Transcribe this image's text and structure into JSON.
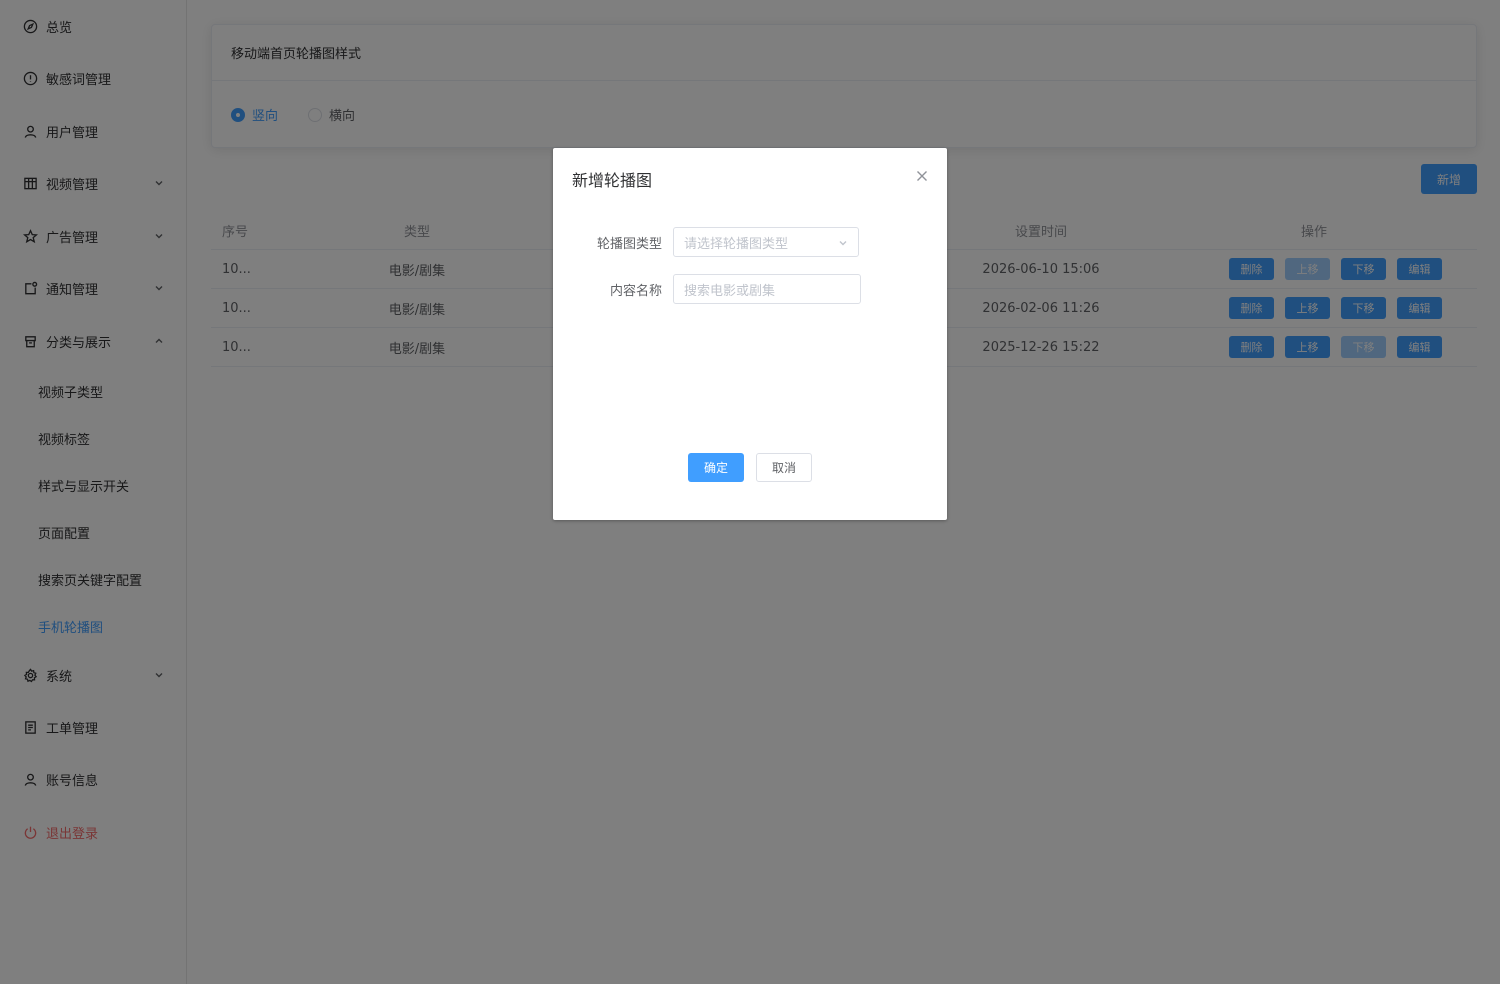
{
  "sidebar": {
    "items": [
      {
        "label": "总览",
        "icon": "compass-icon"
      },
      {
        "label": "敏感词管理",
        "icon": "warning-circle-icon"
      },
      {
        "label": "用户管理",
        "icon": "user-icon"
      },
      {
        "label": "视频管理",
        "icon": "grid-icon",
        "expandable": true
      },
      {
        "label": "广告管理",
        "icon": "star-icon",
        "expandable": true
      },
      {
        "label": "通知管理",
        "icon": "notification-icon",
        "expandable": true
      },
      {
        "label": "分类与展示",
        "icon": "box-icon",
        "expandable": true,
        "expanded": true
      },
      {
        "label": "系统",
        "icon": "gear-icon",
        "expandable": true
      },
      {
        "label": "工单管理",
        "icon": "document-icon"
      },
      {
        "label": "账号信息",
        "icon": "user-icon"
      },
      {
        "label": "退出登录",
        "icon": "power-icon",
        "color": "#f56c6c"
      }
    ],
    "subitems": [
      {
        "label": "视频子类型"
      },
      {
        "label": "视频标签"
      },
      {
        "label": "样式与显示开关"
      },
      {
        "label": "页面配置"
      },
      {
        "label": "搜索页关键字配置"
      },
      {
        "label": "手机轮播图",
        "active": true
      }
    ]
  },
  "card": {
    "title": "移动端首页轮播图样式",
    "options": [
      {
        "label": "竖向",
        "checked": true
      },
      {
        "label": "横向",
        "checked": false
      }
    ]
  },
  "add_button": "新增",
  "table": {
    "headers": {
      "seq": "序号",
      "type": "类型",
      "time": "设置时间",
      "ops": "操作"
    },
    "rows": [
      {
        "seq": "10...",
        "type": "电影/剧集",
        "time": "2026-06-10 15:06",
        "up_disabled": true,
        "down_disabled": false
      },
      {
        "seq": "10...",
        "type": "电影/剧集",
        "time": "2026-02-06 11:26",
        "up_disabled": false,
        "down_disabled": false
      },
      {
        "seq": "10...",
        "type": "电影/剧集",
        "time": "2025-12-26 15:22",
        "up_disabled": false,
        "down_disabled": true
      }
    ],
    "op_labels": {
      "delete": "删除",
      "up": "上移",
      "down": "下移",
      "edit": "编辑"
    }
  },
  "dialog": {
    "title": "新增轮播图",
    "fields": {
      "type_label": "轮播图类型",
      "type_placeholder": "请选择轮播图类型",
      "name_label": "内容名称",
      "name_placeholder": "搜索电影或剧集"
    },
    "confirm": "确定",
    "cancel": "取消"
  },
  "colors": {
    "primary": "#409eff",
    "primary_disabled": "#a0cfff",
    "danger": "#f56c6c"
  }
}
